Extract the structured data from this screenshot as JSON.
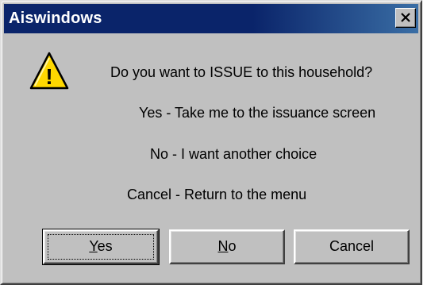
{
  "window": {
    "title": "Aiswindows",
    "close_glyph": "✕"
  },
  "icon": {
    "name": "warning-icon",
    "glyph": "!",
    "color": "#ffd800"
  },
  "message": {
    "question": "Do you want to ISSUE to this household?",
    "line_yes": "Yes - Take me to the issuance screen",
    "line_no": "No  - I want another choice",
    "line_cancel": "Cancel - Return to the menu"
  },
  "buttons": {
    "yes": {
      "accel": "Y",
      "rest": "es"
    },
    "no": {
      "accel": "N",
      "rest": "o"
    },
    "cancel": {
      "label": "Cancel"
    }
  }
}
